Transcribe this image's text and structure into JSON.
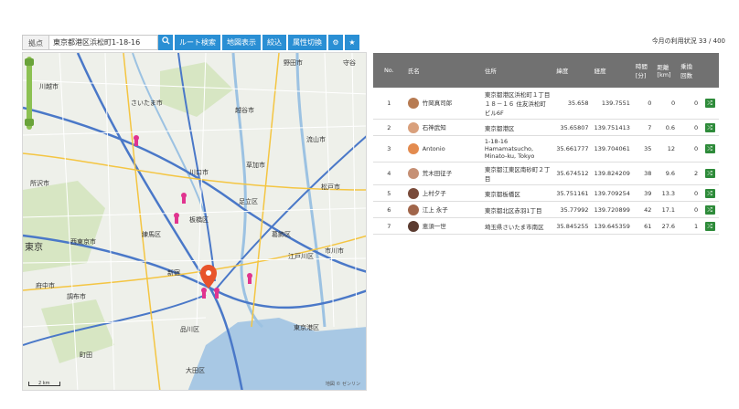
{
  "toolbar": {
    "base_label": "拠点",
    "address_value": "東京都港区浜松町1-18-16",
    "search_icon": "search-icon",
    "route_search": "ルート検索",
    "map_display": "地図表示",
    "filter": "絞込",
    "attribute_switch": "属性切換",
    "settings_icon": "gear-icon",
    "favorite_icon": "star-icon"
  },
  "usage": {
    "text": "今月の利用状況  33 / 400"
  },
  "map": {
    "labels": [
      "野田市",
      "守谷",
      "川越市",
      "さいたま市",
      "越谷市",
      "流山市",
      "所沢市",
      "川口市",
      "草加市",
      "松戸市",
      "足立区",
      "練馬区",
      "板橋区",
      "西東京市",
      "葛飾区",
      "江戸川区",
      "東京",
      "新宿",
      "調布市",
      "品川区",
      "東京港区",
      "大田区",
      "府中市",
      "町田",
      "市川市"
    ],
    "credit": "地図 © ゼンリン",
    "scale": "2 km",
    "colors": {
      "water": "#a8c8e4",
      "road": "#ffffff",
      "highway": "#4a78c8",
      "trunk": "#f4c542",
      "green": "#c9dfb0",
      "pin": "#e0348f",
      "base_pin": "#e8542b"
    }
  },
  "table": {
    "headers": [
      "No.",
      "氏名",
      "住所",
      "緯度",
      "経度",
      "時間 [分]",
      "距離 [km]",
      "乗換 回数",
      ""
    ],
    "rows": [
      {
        "no": "1",
        "name": "竹岡真司郎",
        "address": "東京都港区浜松町１丁目１８－１６ 住友浜松町ビル6F",
        "lat": "35.658",
        "lng": "139.7551",
        "time": "0",
        "dist": "0",
        "transfers": "0",
        "avatar": "#b77b52"
      },
      {
        "no": "2",
        "name": "石神武知",
        "address": "東京都港区",
        "lat": "35.65807",
        "lng": "139.751413",
        "time": "7",
        "dist": "0.6",
        "transfers": "0",
        "avatar": "#d9a07c"
      },
      {
        "no": "3",
        "name": "Antonio",
        "address": "1-18-16 Hamamatsucho, Minato-ku, Tokyo",
        "lat": "35.661777",
        "lng": "139.704061",
        "time": "35",
        "dist": "12",
        "transfers": "0",
        "avatar": "#e38b4f"
      },
      {
        "no": "4",
        "name": "荒木田征子",
        "address": "東京都江東区南砂町２丁目",
        "lat": "35.674512",
        "lng": "139.824209",
        "time": "38",
        "dist": "9.6",
        "transfers": "2",
        "avatar": "#c69075"
      },
      {
        "no": "5",
        "name": "上村夕子",
        "address": "東京都板橋区",
        "lat": "35.751161",
        "lng": "139.709254",
        "time": "39",
        "dist": "13.3",
        "transfers": "0",
        "avatar": "#7a4b3a"
      },
      {
        "no": "6",
        "name": "江上 永子",
        "address": "東京都北区赤羽1丁目",
        "lat": "35.77992",
        "lng": "139.720899",
        "time": "42",
        "dist": "17.1",
        "transfers": "0",
        "avatar": "#a0654a"
      },
      {
        "no": "7",
        "name": "恵須一世",
        "address": "埼玉県さいたま市南区",
        "lat": "35.845255",
        "lng": "139.645359",
        "time": "61",
        "dist": "27.6",
        "transfers": "1",
        "avatar": "#5b3b30"
      }
    ],
    "route_icon": "route-icon"
  }
}
